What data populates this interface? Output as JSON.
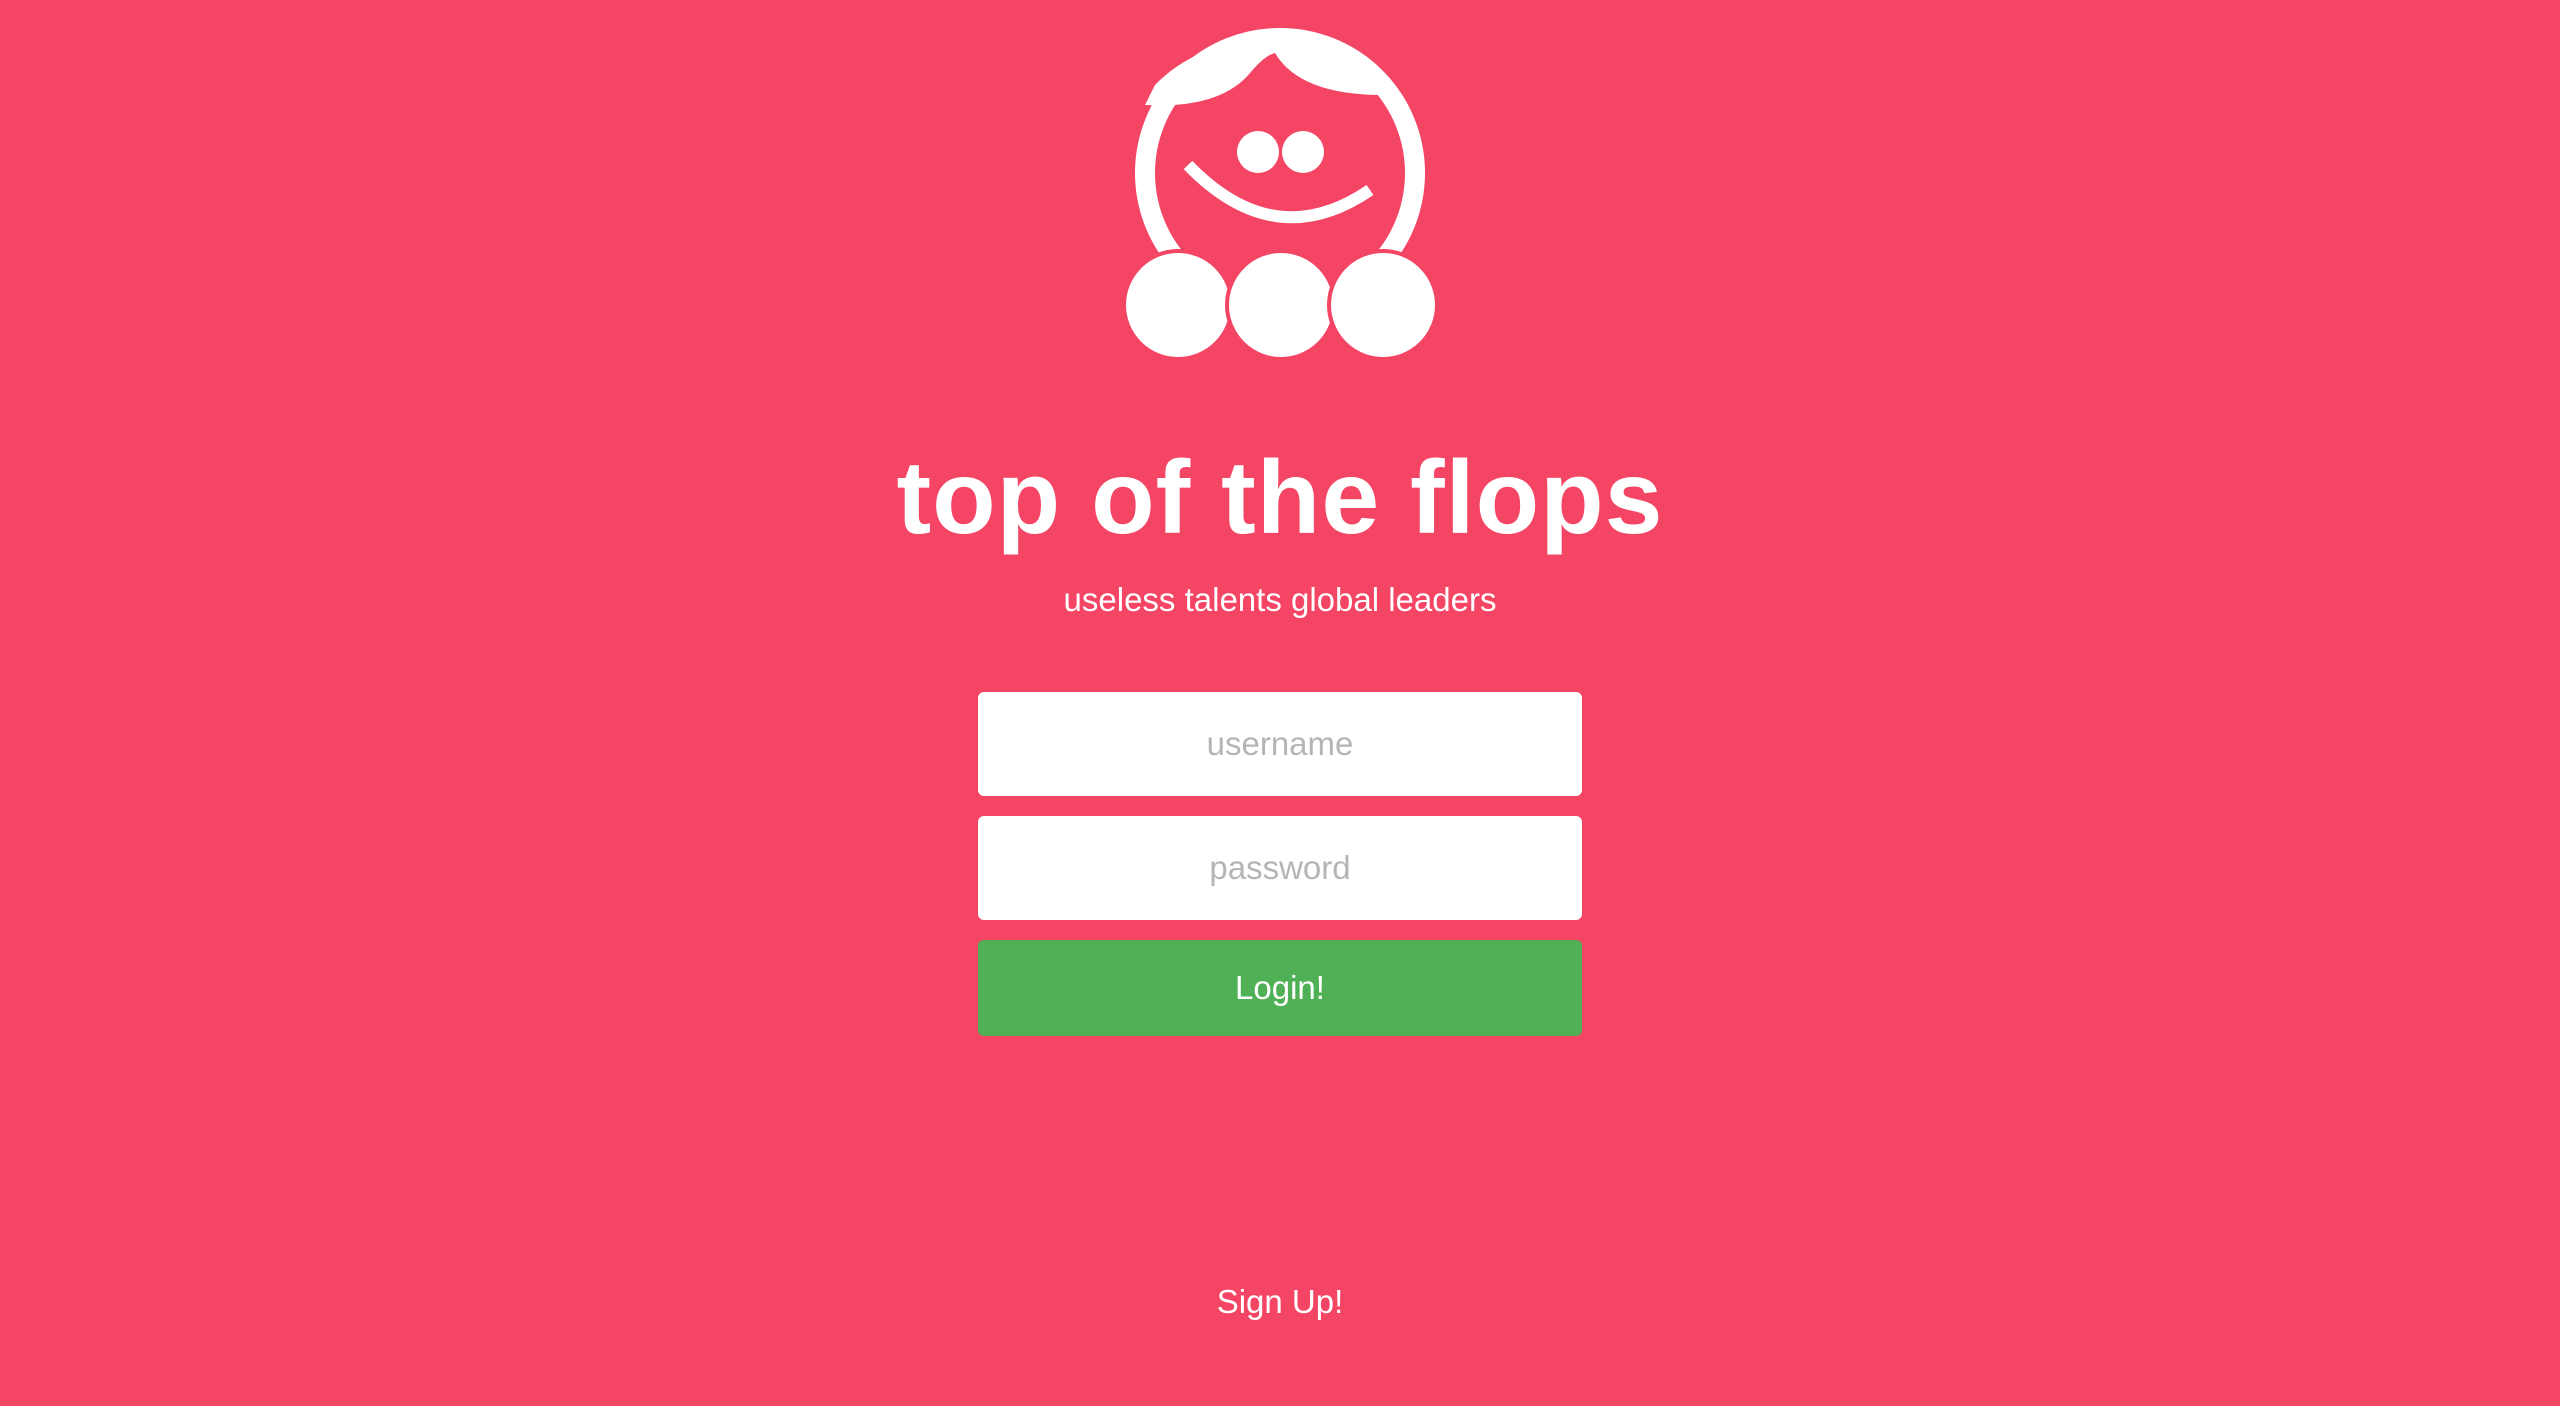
{
  "colors": {
    "background": "#f44565",
    "primary_button": "#4fb055",
    "text": "#ffffff",
    "placeholder": "#b5b5b5"
  },
  "branding": {
    "logo_icon": "smiling-face-with-curl-and-three-circles-icon",
    "title": "top of the flops",
    "subtitle": "useless talents global leaders"
  },
  "login_form": {
    "username_placeholder": "username",
    "password_placeholder": "password",
    "submit_label": "Login!"
  },
  "footer": {
    "signup_label": "Sign Up!"
  }
}
